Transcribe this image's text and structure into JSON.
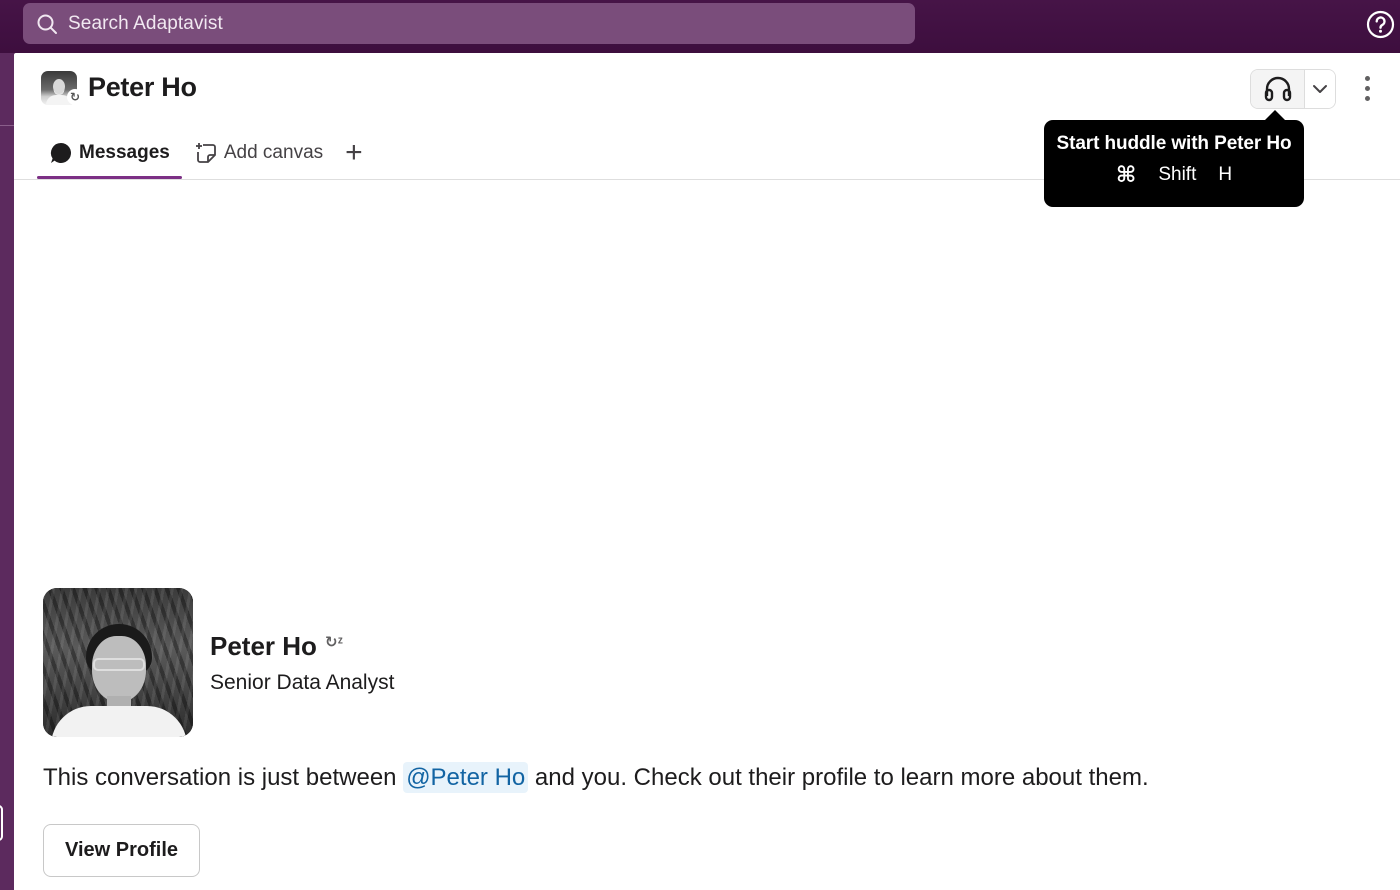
{
  "topbar": {
    "search_placeholder": "Search Adaptavist",
    "search_icon": "search-icon",
    "help_icon": "help-circle-icon"
  },
  "header": {
    "name": "Peter Ho",
    "status_icon": "dnd-snooze-icon",
    "huddle_icon": "headphones-icon",
    "huddle_menu_icon": "chevron-down-icon",
    "more_icon": "kebab-vertical-icon"
  },
  "tabs": [
    {
      "label": "Messages",
      "icon": "message-bubble-icon",
      "active": true
    },
    {
      "label": "Add canvas",
      "icon": "canvas-add-icon",
      "active": false
    },
    {
      "label": "+",
      "icon": "plus-icon",
      "active": false
    }
  ],
  "tooltip": {
    "title": "Start huddle with Peter Ho",
    "keys": [
      "⌘",
      "Shift",
      "H"
    ]
  },
  "intro": {
    "name": "Peter Ho",
    "status_glyph": "↻ᶻ",
    "job_title": "Senior Data Analyst",
    "text_before": "This conversation is just between ",
    "mention": "@Peter Ho",
    "text_after": " and you. Check out their profile to learn more about them.",
    "view_profile_label": "View Profile"
  },
  "colors": {
    "topbar": "#3f0e40",
    "search_bg": "#7a4d7b",
    "sidebar": "#5c2a5e",
    "tab_accent": "#7c3085",
    "mention_text": "#1264a3",
    "mention_bg": "#e8f3fb"
  }
}
